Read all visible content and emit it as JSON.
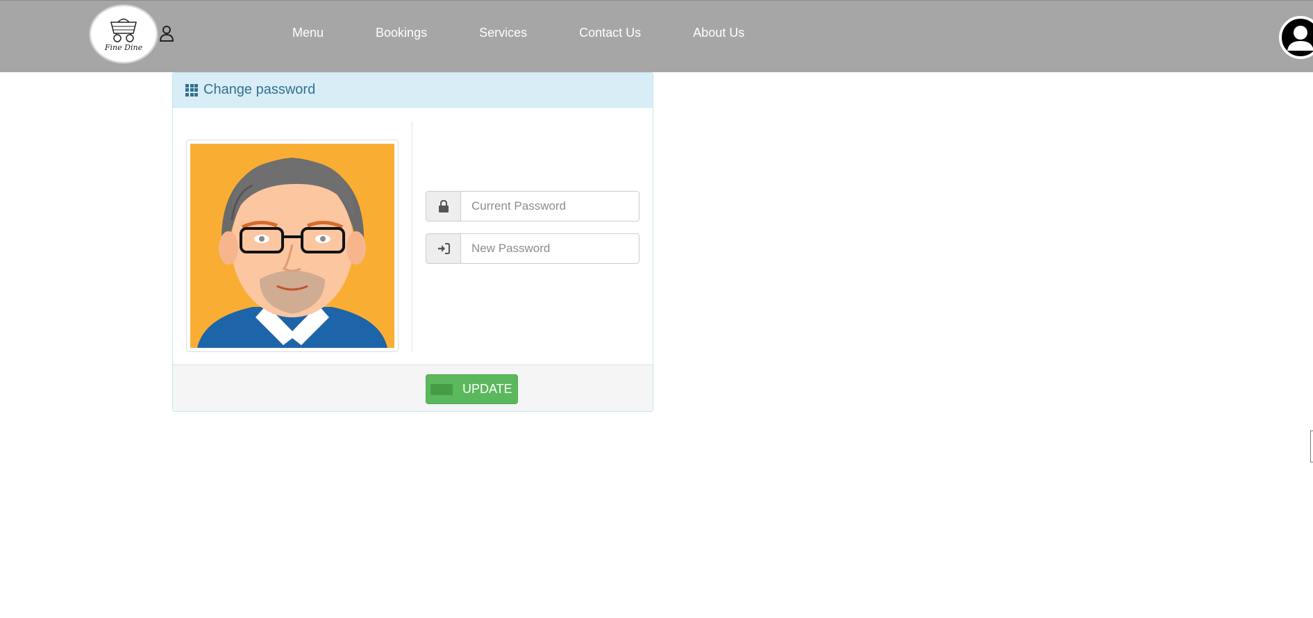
{
  "brand": {
    "logo_text": "Fine Dine"
  },
  "nav": {
    "links": [
      {
        "label": "Menu"
      },
      {
        "label": "Bookings"
      },
      {
        "label": "Services"
      },
      {
        "label": "Contact Us"
      },
      {
        "label": "About Us"
      }
    ]
  },
  "panel": {
    "title": "Change password",
    "title_icon": "grid-icon",
    "current_password": {
      "placeholder": "Current Password",
      "icon": "lock-icon"
    },
    "new_password": {
      "placeholder": "New Password",
      "icon": "sign-in-icon"
    },
    "update_label": "UPDATE"
  },
  "colors": {
    "navbar": "#a6a6a6",
    "panel_heading": "#d9edf7",
    "panel_heading_text": "#31708f",
    "update_button": "#5cb85c",
    "avatar_background": "#f9ae33"
  }
}
